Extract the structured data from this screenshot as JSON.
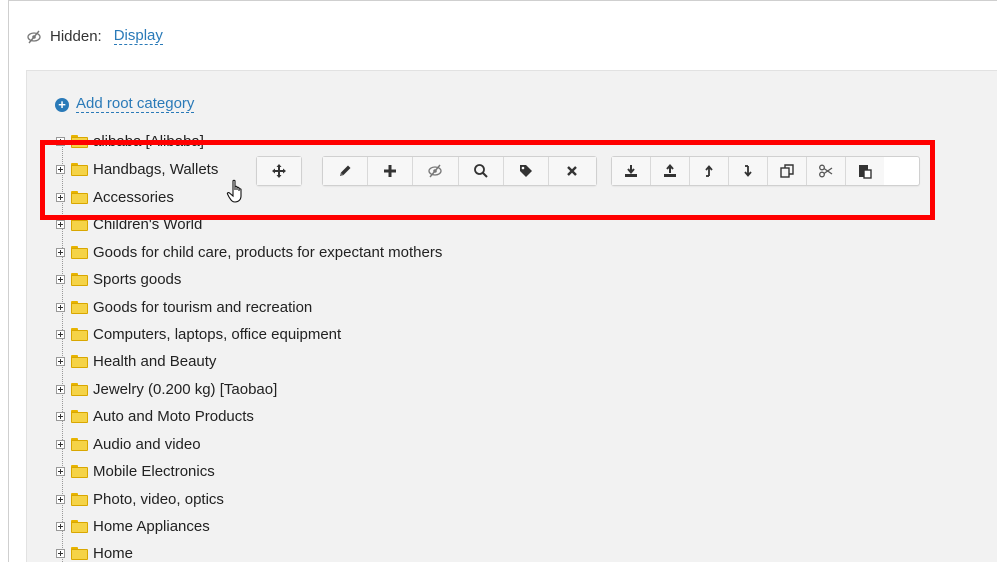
{
  "header": {
    "hidden_label": "Hidden:",
    "display_link": "Display"
  },
  "add_root": {
    "label": "Add root category"
  },
  "categories": [
    "alibaba [Alibaba]",
    "Handbags, Wallets",
    "Accessories",
    "Children's World",
    "Goods for child care, products for expectant mothers",
    "Sports goods",
    "Goods for tourism and recreation",
    "Computers, laptops, office equipment",
    "Health and Beauty",
    "Jewelry (0.200 kg) [Taobao]",
    "Auto and Moto Products",
    "Audio and video",
    "Mobile Electronics",
    "Photo, video, optics",
    "Home Appliances",
    "Home"
  ],
  "toolbar": {
    "move_icon": "move-icon",
    "edit_icon": "pencil-icon",
    "add_icon": "plus-icon",
    "hide_icon": "eye-slash-icon",
    "search_icon": "search-icon",
    "tag_icon": "tag-icon",
    "delete_icon": "close-icon",
    "import_icon": "download-icon",
    "export_icon": "upload-icon",
    "up_icon": "arrow-up-icon",
    "down_icon": "arrow-down-icon",
    "copy_icon": "copy-icon",
    "cut_icon": "scissors-icon",
    "paste_icon": "paste-icon"
  },
  "colors": {
    "link": "#2a7ab8",
    "highlight": "#ff0000",
    "folder": "#f5d347"
  }
}
